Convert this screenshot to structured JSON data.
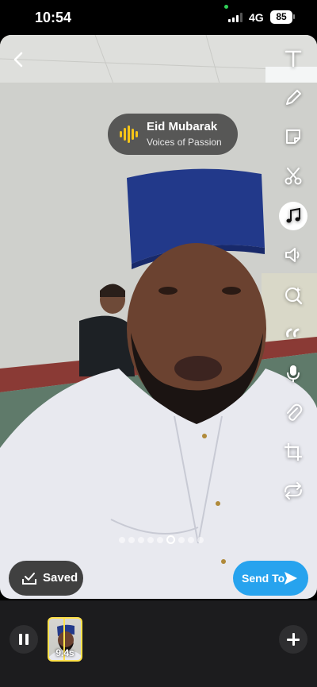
{
  "status_bar": {
    "time": "10:54",
    "network": "4G",
    "battery": "85"
  },
  "music_sticker": {
    "title": "Eid Mubarak",
    "subtitle": "Voices of Passion",
    "icon": "audio-wave-icon",
    "accent": "#f5c518"
  },
  "toolbar": {
    "tools": [
      "text-icon",
      "pencil-icon",
      "sticker-icon",
      "scissors-icon",
      "music-note-icon",
      "volume-icon",
      "ai-lens-icon",
      "quote-icon",
      "microphone-icon",
      "paperclip-icon",
      "crop-icon",
      "loop-icon"
    ],
    "active_tool": "music-note-icon"
  },
  "carousel": {
    "count": 9,
    "active_index": 5
  },
  "actions": {
    "saved_label": "Saved",
    "send_label": "Send To",
    "send_color": "#27a3ee"
  },
  "timeline": {
    "duration": "9.4s"
  }
}
